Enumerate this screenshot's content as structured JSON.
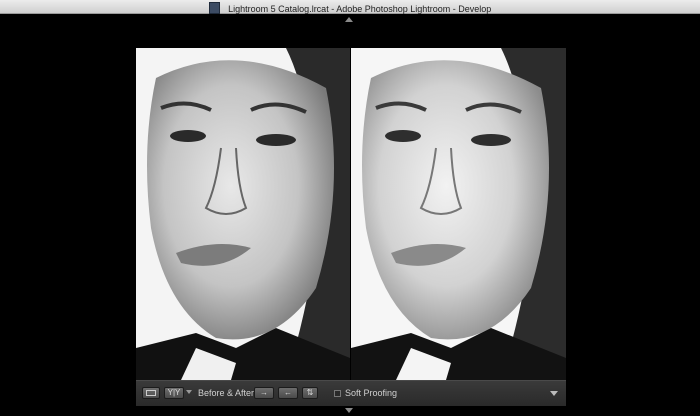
{
  "window": {
    "title": "Lightroom 5 Catalog.lrcat - Adobe Photoshop Lightroom - Develop"
  },
  "toolbar": {
    "view_toggle_label": "Y|Y",
    "before_after_label": "Before & After :",
    "copy_before_to_after": "→",
    "copy_after_to_before": "←",
    "swap_label": "⇅",
    "soft_proofing_label": "Soft Proofing",
    "soft_proofing_checked": false
  },
  "icons": {
    "doc": "document-icon",
    "loupe": "loupe-view-icon",
    "menu": "chevron-down-icon"
  }
}
